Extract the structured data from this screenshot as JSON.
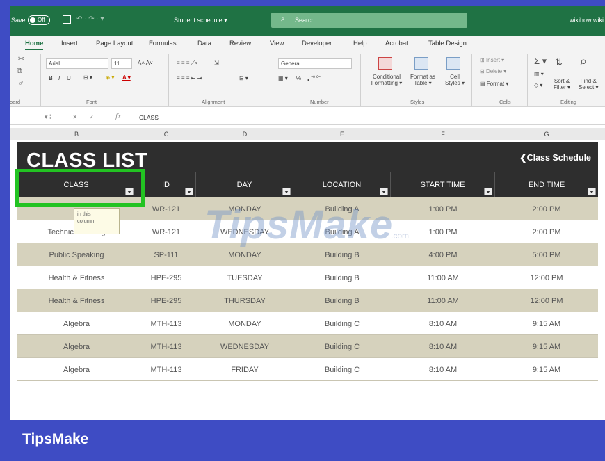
{
  "titlebar": {
    "autosave": "Save",
    "toggle": "Off",
    "document": "Student schedule",
    "search": "Search",
    "user": "wikihow wiki"
  },
  "tabs": [
    "Home",
    "Insert",
    "Page Layout",
    "Formulas",
    "Data",
    "Review",
    "View",
    "Developer",
    "Help",
    "Acrobat",
    "Table Design"
  ],
  "ribbon": {
    "font_name": "Arial",
    "font_size": "11",
    "number_format": "General",
    "groups": {
      "font": "Font",
      "alignment": "Alignment",
      "number": "Number",
      "styles": "Styles",
      "cells": "Cells",
      "editing": "Editing",
      "board": "oard"
    },
    "buttons": {
      "conditional_formatting_1": "Conditional",
      "conditional_formatting_2": "Formatting",
      "format_table_1": "Format as",
      "format_table_2": "Table",
      "cell_styles_1": "Cell",
      "cell_styles_2": "Styles",
      "insert": "Insert",
      "delete": "Delete",
      "format": "Format",
      "sort_1": "Sort &",
      "sort_2": "Filter",
      "find_1": "Find &",
      "find_2": "Select"
    },
    "percent": "%"
  },
  "formula_bar": {
    "fx": "fx",
    "value": "CLASS"
  },
  "column_headers": [
    "B",
    "C",
    "D",
    "E",
    "F",
    "G"
  ],
  "sheet": {
    "title": "CLASS LIST",
    "link": "❮Class Schedule",
    "headers": [
      "CLASS",
      "ID",
      "DAY",
      "LOCATION",
      "START TIME",
      "END TIME"
    ],
    "tooltip": [
      "in this",
      "column"
    ],
    "rows": [
      [
        "",
        "WR-121",
        "MONDAY",
        "Building A",
        "1:00 PM",
        "2:00 PM"
      ],
      [
        "Technical Writing",
        "WR-121",
        "WEDNESDAY",
        "Building A",
        "1:00 PM",
        "2:00 PM"
      ],
      [
        "Public Speaking",
        "SP-111",
        "MONDAY",
        "Building B",
        "4:00 PM",
        "5:00 PM"
      ],
      [
        "Health & Fitness",
        "HPE-295",
        "TUESDAY",
        "Building B",
        "11:00 AM",
        "12:00 PM"
      ],
      [
        "Health & Fitness",
        "HPE-295",
        "THURSDAY",
        "Building B",
        "11:00 AM",
        "12:00 PM"
      ],
      [
        "Algebra",
        "MTH-113",
        "MONDAY",
        "Building C",
        "8:10 AM",
        "9:15 AM"
      ],
      [
        "Algebra",
        "MTH-113",
        "WEDNESDAY",
        "Building C",
        "8:10 AM",
        "9:15 AM"
      ],
      [
        "Algebra",
        "MTH-113",
        "FRIDAY",
        "Building C",
        "8:10 AM",
        "9:15 AM"
      ]
    ]
  },
  "watermark": {
    "text": "TipsMake",
    "suffix": ".com"
  },
  "brand": "TipsMake",
  "colors": {
    "excel_green": "#1f7244",
    "frame_blue": "#3e4cc4",
    "highlight_green": "#22c322",
    "table_dark": "#2e2e2e",
    "row_tan": "#d6d2bd"
  }
}
